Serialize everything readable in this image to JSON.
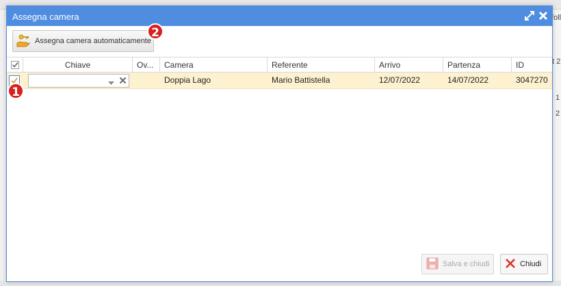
{
  "background": {
    "fragment_top_right": "follow",
    "fragment_right_1": "t 2",
    "fragment_right_2": "1",
    "fragment_right_3": "2"
  },
  "dialog": {
    "title": "Assegna camera",
    "toolbar": {
      "auto_assign_label": "Assegna camera automaticamente",
      "auto_assign_icon": "hand-key-icon"
    },
    "markers": [
      "1",
      "2"
    ],
    "grid": {
      "columns": [
        "Chiave",
        "Ov...",
        "Camera",
        "Referente",
        "Arrivo",
        "Partenza",
        "ID"
      ],
      "rows": [
        {
          "chiave": "",
          "ov": "",
          "camera": "Doppia Lago",
          "referente": "Mario Battistella",
          "arrivo": "12/07/2022",
          "partenza": "14/07/2022",
          "id": "3047270"
        }
      ]
    },
    "footer": {
      "save_label": "Salva e chiudi",
      "close_label": "Chiudi"
    }
  },
  "colors": {
    "titlebar": "#4f8de0",
    "selected_row": "#fdf1cf",
    "marker": "#d72020",
    "close_x": "#d9342b"
  }
}
